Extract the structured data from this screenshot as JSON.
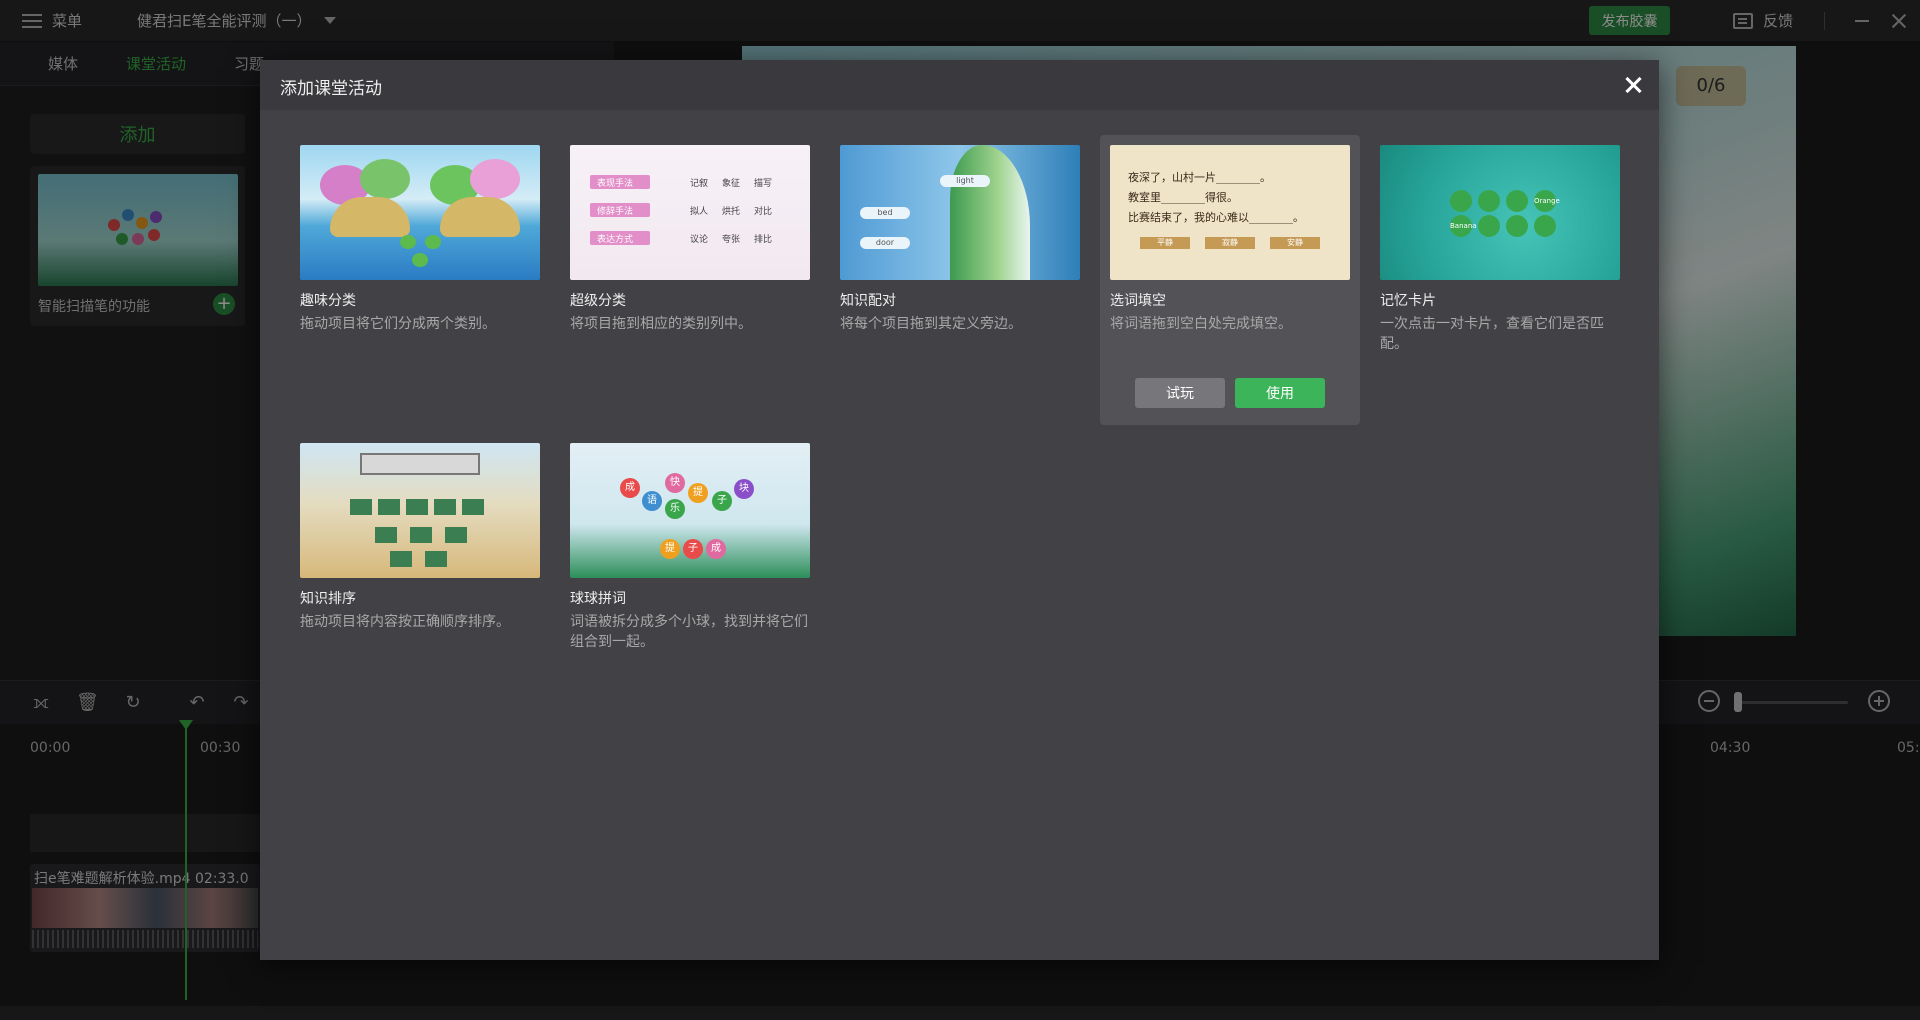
{
  "topbar": {
    "menu_label": "菜单",
    "doc_title": "健君扫E笔全能评测（一）",
    "publish_label": "发布胶囊",
    "feedback_label": "反馈"
  },
  "left_tabs": [
    "媒体",
    "课堂活动",
    "习题"
  ],
  "left_panel": {
    "add_label": "添加",
    "activity_name": "智能扫描笔的功能"
  },
  "preview": {
    "score": "0/6"
  },
  "timeline": {
    "ticks": [
      "00:00",
      "00:30",
      "04:30",
      "05:"
    ],
    "clip_label": "扫e笔难题解析体验.mp4  02:33.0"
  },
  "modal": {
    "title": "添加课堂活动",
    "try_label": "试玩",
    "use_label": "使用",
    "cards": [
      {
        "title": "趣味分类",
        "desc": "拖动项目将它们分成两个类别。"
      },
      {
        "title": "超级分类",
        "desc": "将项目拖到相应的类别列中。"
      },
      {
        "title": "知识配对",
        "desc": "将每个项目拖到其定义旁边。"
      },
      {
        "title": "选词填空",
        "desc": "将词语拖到空白处完成填空。"
      },
      {
        "title": "记忆卡片",
        "desc": "一次点击一对卡片，查看它们是否匹配。"
      },
      {
        "title": "知识排序",
        "desc": "拖动项目将内容按正确顺序排序。"
      },
      {
        "title": "球球拼词",
        "desc": "词语被拆分成多个小球，找到并将它们组合到一起。"
      }
    ]
  },
  "thumb_text": {
    "c2": [
      "表现手法",
      "修辞手法",
      "表达方式",
      "记叙",
      "象征",
      "描写",
      "拟人",
      "烘托",
      "对比",
      "议论",
      "夸张",
      "排比"
    ],
    "c3": [
      "light",
      "bed",
      "door"
    ],
    "c4_lines": [
      "夜深了，山村一片________。",
      "教室里________得很。",
      "比赛结束了，我的心难以________。"
    ],
    "c4_opts": [
      "平静",
      "寂静",
      "安静"
    ],
    "c5": [
      "Orange",
      "Banana"
    ],
    "c7": [
      "成",
      "语",
      "提",
      "子",
      "块",
      "快",
      "乐",
      "提",
      "子",
      "成"
    ]
  },
  "colors": {
    "accent": "#39b54a",
    "use_button": "#3bb45a",
    "modal_bg": "#424246"
  }
}
